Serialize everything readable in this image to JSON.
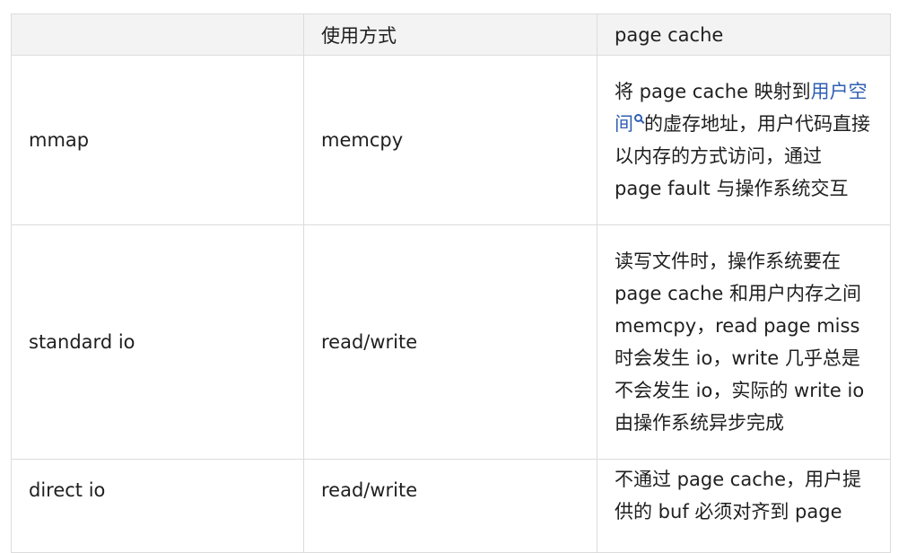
{
  "table": {
    "headers": [
      "",
      "使用方式",
      "page cache"
    ],
    "rows": [
      {
        "name": "mmap",
        "usage": "memcpy",
        "desc_before": "将 page cache 映射到",
        "desc_link": "用户空间",
        "desc_after": "的虚存地址，用户代码直接以内存的方式访问，通过 page fault 与操作系统交互"
      },
      {
        "name": "standard io",
        "usage": "read/write",
        "desc": "读写文件时，操作系统要在 page cache 和用户内存之间 memcpy，read page miss 时会发生 io，write 几乎总是不会发生 io，实际的 write io 由操作系统异步完成"
      },
      {
        "name": "direct io",
        "usage": "read/write",
        "desc": "不通过 page cache，用户提供的 buf 必须对齐到 page"
      }
    ]
  },
  "icons": {
    "link_icon": "search-icon",
    "link_color": "#2f5fb3"
  }
}
